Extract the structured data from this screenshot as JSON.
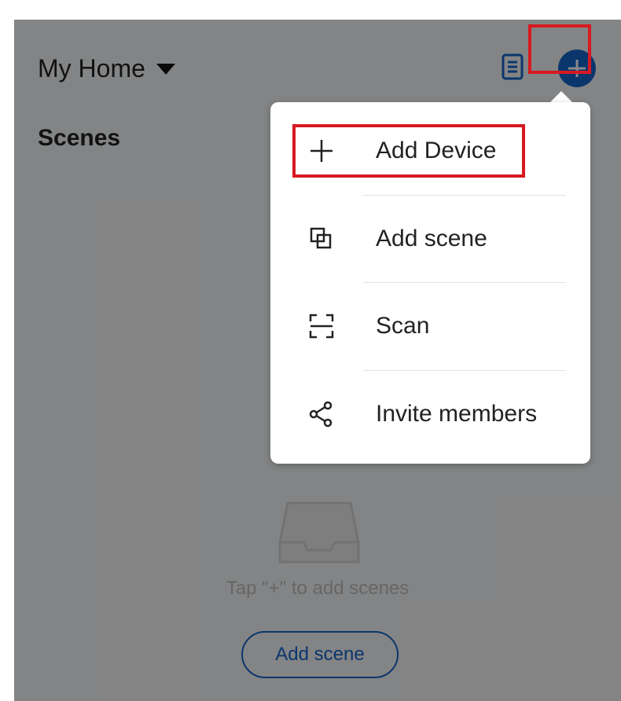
{
  "header": {
    "home_name": "My Home"
  },
  "section": {
    "title": "Scenes"
  },
  "empty_state": {
    "message": "Tap \"+\" to add scenes",
    "button_label": "Add scene"
  },
  "menu": {
    "items": [
      {
        "label": "Add Device",
        "icon": "plus-icon"
      },
      {
        "label": "Add scene",
        "icon": "scene-icon"
      },
      {
        "label": "Scan",
        "icon": "scan-icon"
      },
      {
        "label": "Invite members",
        "icon": "share-icon"
      }
    ]
  },
  "colors": {
    "accent": "#1565c8",
    "highlight_box": "#d71920",
    "overlay": "rgba(0,0,0,0.46)"
  }
}
